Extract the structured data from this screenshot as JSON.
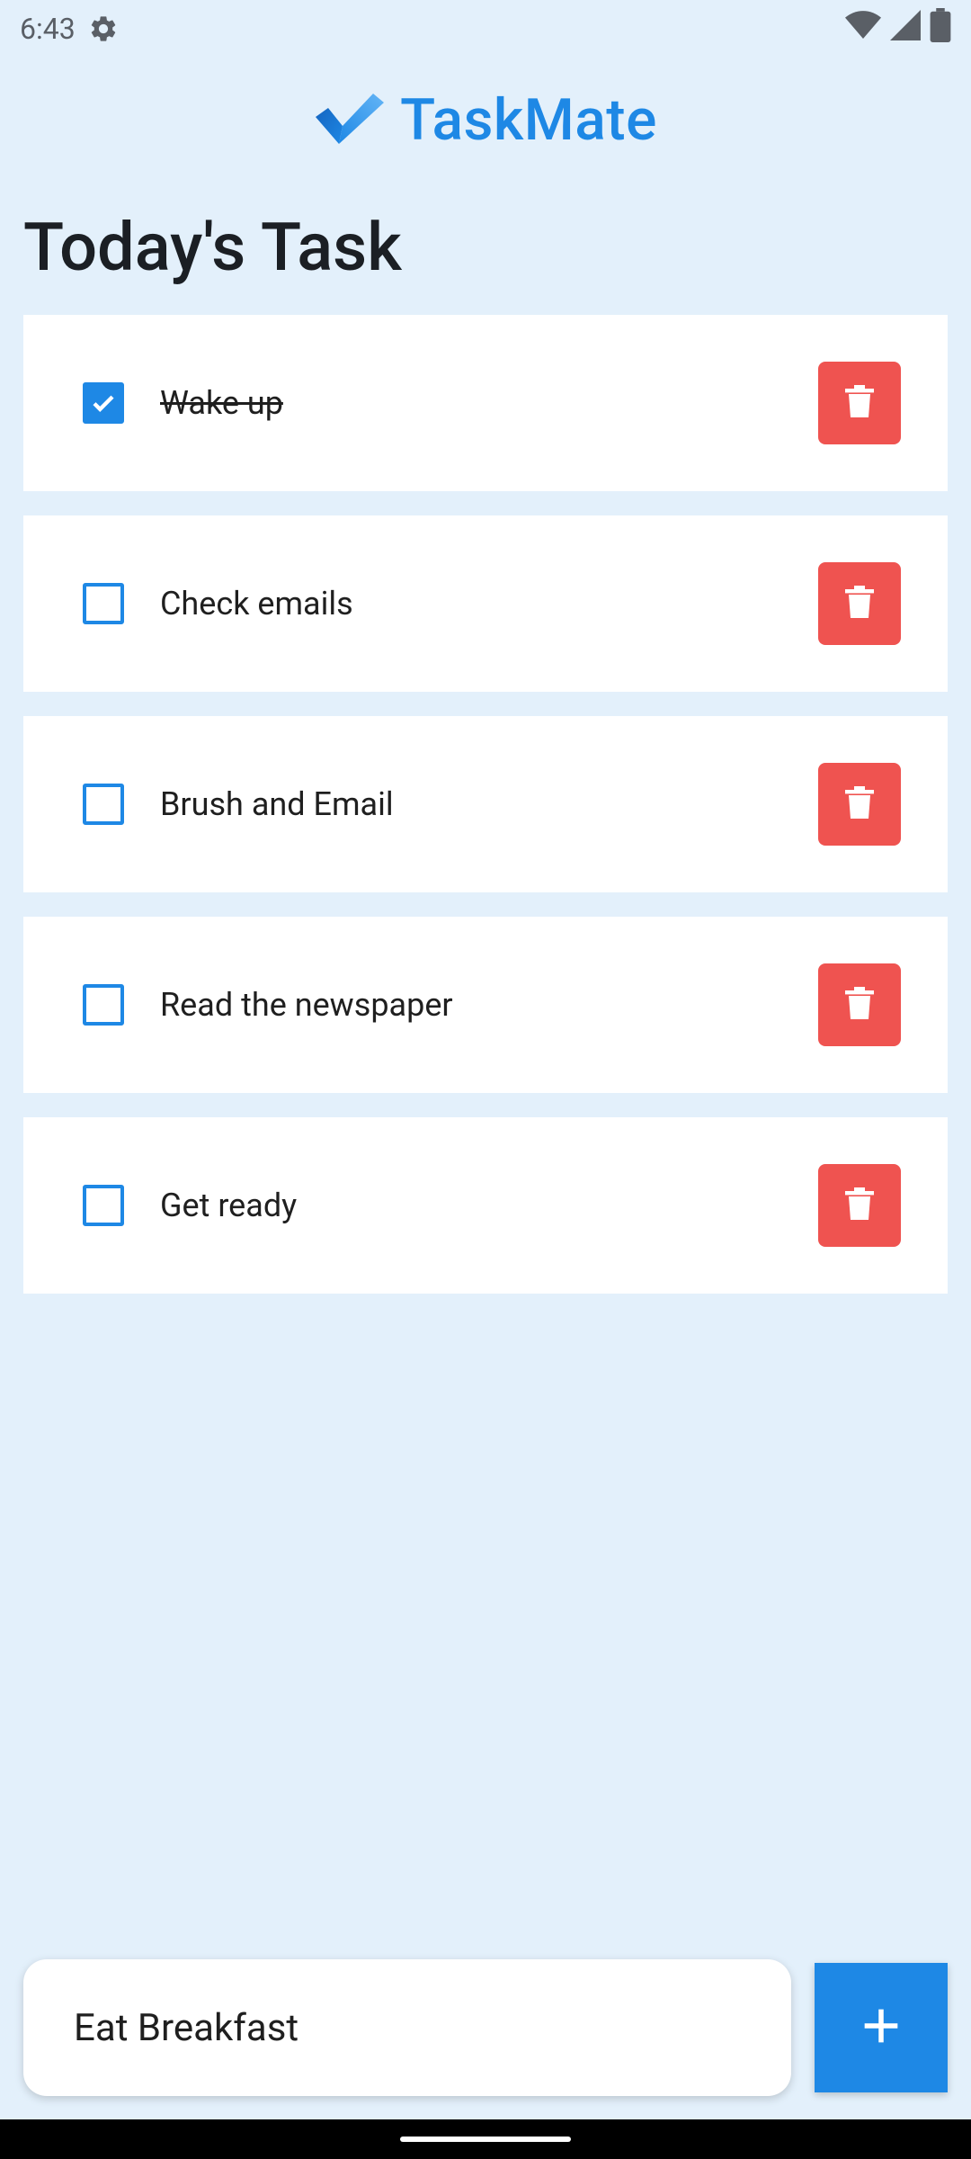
{
  "status_bar": {
    "time": "6:43"
  },
  "app": {
    "title": "TaskMate"
  },
  "page": {
    "title": "Today's Task"
  },
  "tasks": [
    {
      "label": "Wake up",
      "checked": true
    },
    {
      "label": "Check emails",
      "checked": false
    },
    {
      "label": "Brush and Email",
      "checked": false
    },
    {
      "label": "Read the newspaper",
      "checked": false
    },
    {
      "label": "Get ready",
      "checked": false
    }
  ],
  "new_task": {
    "value": "Eat Breakfast"
  },
  "colors": {
    "background": "#e3f0fb",
    "accent": "#1e88e5",
    "delete": "#ef5350"
  },
  "icons": {
    "settings": "gear-icon",
    "wifi": "wifi-icon",
    "signal": "signal-icon",
    "battery": "battery-icon",
    "logo": "checkmark-logo",
    "delete": "trash-icon",
    "add": "plus-icon"
  }
}
